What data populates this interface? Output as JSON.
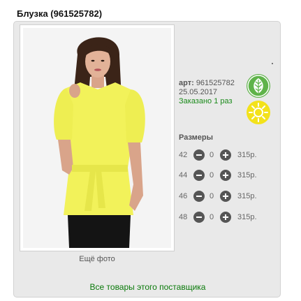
{
  "product": {
    "title": "Блузка (961525782)",
    "art_label": "арт:",
    "art_value": "961525782",
    "date": "25.05.2017",
    "ordered": "Заказано 1 раз"
  },
  "photo": {
    "more_label": "Ещё фото"
  },
  "sizes": {
    "title": "Размеры",
    "rows": [
      {
        "size": "42",
        "qty": "0",
        "price": "315р."
      },
      {
        "size": "44",
        "qty": "0",
        "price": "315р."
      },
      {
        "size": "46",
        "qty": "0",
        "price": "315р."
      },
      {
        "size": "48",
        "qty": "0",
        "price": "315р."
      }
    ]
  },
  "supplier_link": "Все товары этого поставщика",
  "badges": {
    "eco_icon": "leaf-icon",
    "eco_color": "#5fb34a",
    "sun_icon": "sun-icon",
    "sun_color": "#f3e21b"
  },
  "colors": {
    "card_background": "#e9e9e9",
    "link": "#0a7a0a",
    "blouse": "#f2f25a"
  }
}
